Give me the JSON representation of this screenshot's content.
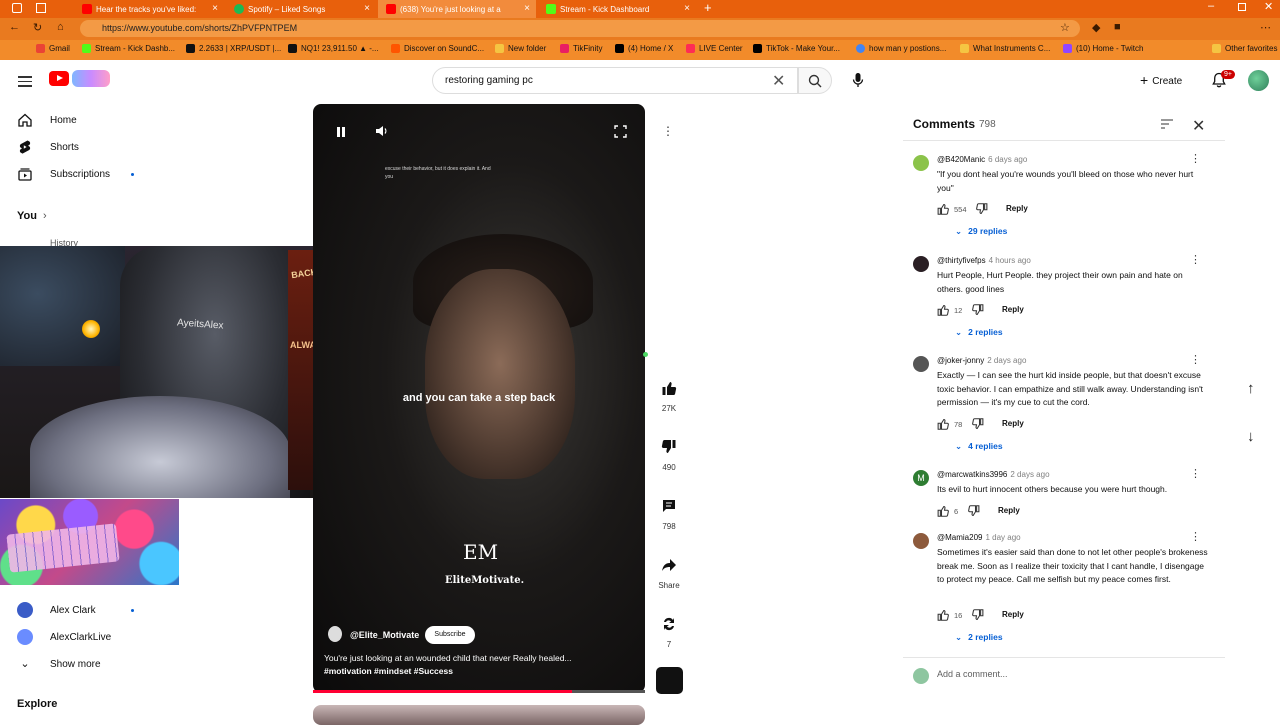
{
  "browser": {
    "tabs": [
      {
        "title": "Hear the tracks you've liked:",
        "color": "#ff0000"
      },
      {
        "title": "Spotify – Liked Songs",
        "color": "#1db954"
      },
      {
        "title": "(638) You're just looking at a",
        "color": "#ff0000"
      },
      {
        "title": "Stream - Kick Dashboard",
        "color": "#53fc18"
      }
    ],
    "url": "https://www.youtube.com/shorts/ZhPVFPNTPEM",
    "bookmarks": [
      {
        "label": "Gmail",
        "color": "#ea4335"
      },
      {
        "label": "Stream - Kick Dashb...",
        "color": "#53fc18"
      },
      {
        "label": "2.2633 | XRP/USDT |...",
        "color": "#111111"
      },
      {
        "label": "NQ1! 23,911.50 ▲ -...",
        "color": "#111111"
      },
      {
        "label": "Discover on SoundC...",
        "color": "#ff5500"
      },
      {
        "label": "New folder",
        "color": "#f5c542"
      },
      {
        "label": "TikFinity",
        "color": "#e91e63"
      },
      {
        "label": "(4) Home / X",
        "color": "#000000"
      },
      {
        "label": "LIVE Center",
        "color": "#fe2c55"
      },
      {
        "label": "TikTok - Make Your...",
        "color": "#000000"
      },
      {
        "label": "how man y postions...",
        "color": "#4285f4"
      },
      {
        "label": "What Instruments C...",
        "color": "#f5c542"
      },
      {
        "label": "(10) Home - Twitch",
        "color": "#9146ff"
      },
      {
        "label": "Other favorites",
        "color": "#f5c542"
      }
    ]
  },
  "header": {
    "search_value": "restoring gaming pc",
    "create_label": "Create",
    "notif_badge": "9+"
  },
  "sidebar": {
    "items": [
      {
        "label": "Home"
      },
      {
        "label": "Shorts"
      },
      {
        "label": "Subscriptions"
      }
    ],
    "you_label": "You",
    "history_label": "History",
    "subs": [
      {
        "label": "Alex Clark"
      },
      {
        "label": "AlexClarkLive"
      }
    ],
    "show_more": "Show more",
    "explore": "Explore"
  },
  "overlay": {
    "cam_tag": "AyeitsAlex",
    "box_brand": "BACKWOODS",
    "box_brand2": "ALWAYS TRUE"
  },
  "video": {
    "caption_small": "excuse their behavior, but it does explain it. And you",
    "caption_main": "and you can take a step back",
    "logo_big": "EM",
    "logo_small": "EliteMotivate.",
    "channel": "@Elite_Motivate",
    "subscribe": "Subscribe",
    "title": "You're just looking at an wounded child that never Really healed...",
    "tags": "#motivation #mindset #Success",
    "progress": 0.78
  },
  "actions": {
    "likes": "27K",
    "dislikes": "490",
    "comments": "798",
    "share": "Share",
    "remix": "7"
  },
  "comments": {
    "title": "Comments",
    "count": "798",
    "add_placeholder": "Add a comment...",
    "items": [
      {
        "user": "@B420Manic",
        "time": "6 days ago",
        "avatar": "#8bc34a",
        "text": "\"If you dont heal you're wounds you'll bleed on those who never hurt you\"",
        "likes": "554",
        "reply": "Reply",
        "replies": "29 replies"
      },
      {
        "user": "@thirtyfivefps",
        "time": "4 hours ago",
        "avatar": "#2a1f24",
        "text": "Hurt People, Hurt People. they project their own pain and hate on others. good lines",
        "likes": "12",
        "reply": "Reply",
        "replies": "2 replies"
      },
      {
        "user": "@joker-jonny",
        "time": "2 days ago",
        "avatar": "#555555",
        "text": "Exactly — I can see the hurt kid inside people, but that doesn't excuse toxic behavior. I can empathize and still walk away. Understanding isn't permission — it's my cue to cut the cord.",
        "likes": "78",
        "reply": "Reply",
        "replies": "4 replies"
      },
      {
        "user": "@marcwatkins3996",
        "time": "2 days ago",
        "avatar": "#2e7d32",
        "initial": "M",
        "text": "Its evil to hurt innocent others because you were hurt though.",
        "likes": "6",
        "reply": "Reply",
        "replies": ""
      },
      {
        "user": "@Mamia209",
        "time": "1 day ago",
        "avatar": "#8d5a3c",
        "text": "Sometimes it's easier said than done to not let other people's brokeness break me. Soon as I realize their toxicity that I cant handle, I disengage to protect my peace. Call me selfish but my peace comes first.",
        "likes": "16",
        "reply": "Reply",
        "replies": "2 replies"
      }
    ]
  }
}
